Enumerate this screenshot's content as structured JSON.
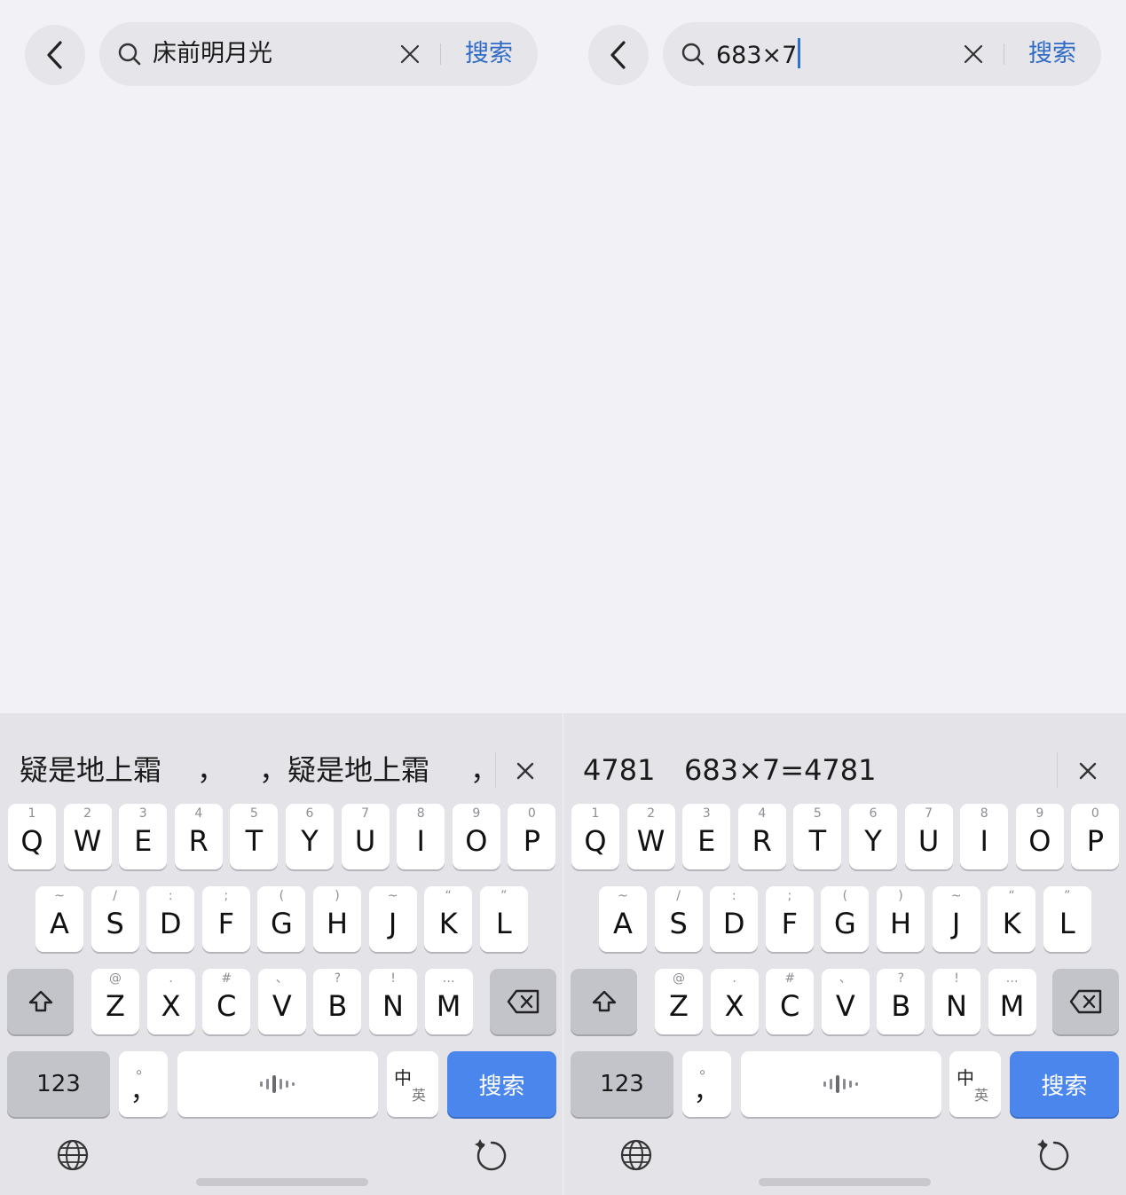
{
  "left": {
    "search": {
      "query": "床前明月光",
      "button": "搜索"
    },
    "candidates": [
      "疑是地上霜",
      "，",
      "，疑是地上霜",
      "，"
    ]
  },
  "right": {
    "search": {
      "query": "683×7",
      "button": "搜索"
    },
    "candidates": [
      "4781",
      "683×7=4781"
    ]
  },
  "keyboard": {
    "row1": [
      {
        "k": "Q",
        "a": "1"
      },
      {
        "k": "W",
        "a": "2"
      },
      {
        "k": "E",
        "a": "3"
      },
      {
        "k": "R",
        "a": "4"
      },
      {
        "k": "T",
        "a": "5"
      },
      {
        "k": "Y",
        "a": "6"
      },
      {
        "k": "U",
        "a": "7"
      },
      {
        "k": "I",
        "a": "8"
      },
      {
        "k": "O",
        "a": "9"
      },
      {
        "k": "P",
        "a": "0"
      }
    ],
    "row2": [
      {
        "k": "A",
        "a": "~"
      },
      {
        "k": "S",
        "a": "/"
      },
      {
        "k": "D",
        "a": ":"
      },
      {
        "k": "F",
        "a": ";"
      },
      {
        "k": "G",
        "a": "("
      },
      {
        "k": "H",
        "a": ")"
      },
      {
        "k": "J",
        "a": "~"
      },
      {
        "k": "K",
        "a": "“"
      },
      {
        "k": "L",
        "a": "”"
      }
    ],
    "row3": [
      {
        "k": "Z",
        "a": "@"
      },
      {
        "k": "X",
        "a": "."
      },
      {
        "k": "C",
        "a": "#"
      },
      {
        "k": "V",
        "a": "、"
      },
      {
        "k": "B",
        "a": "?"
      },
      {
        "k": "N",
        "a": "!"
      },
      {
        "k": "M",
        "a": "…"
      }
    ],
    "num_label": "123",
    "punct_main": "，",
    "punct_alt": "。",
    "lang_zh": "中",
    "lang_en": "英",
    "enter_label": "搜索",
    "colors": {
      "enter": "#4a86ec",
      "search_link": "#2f6bc4",
      "caret": "#2f6fd6"
    }
  }
}
